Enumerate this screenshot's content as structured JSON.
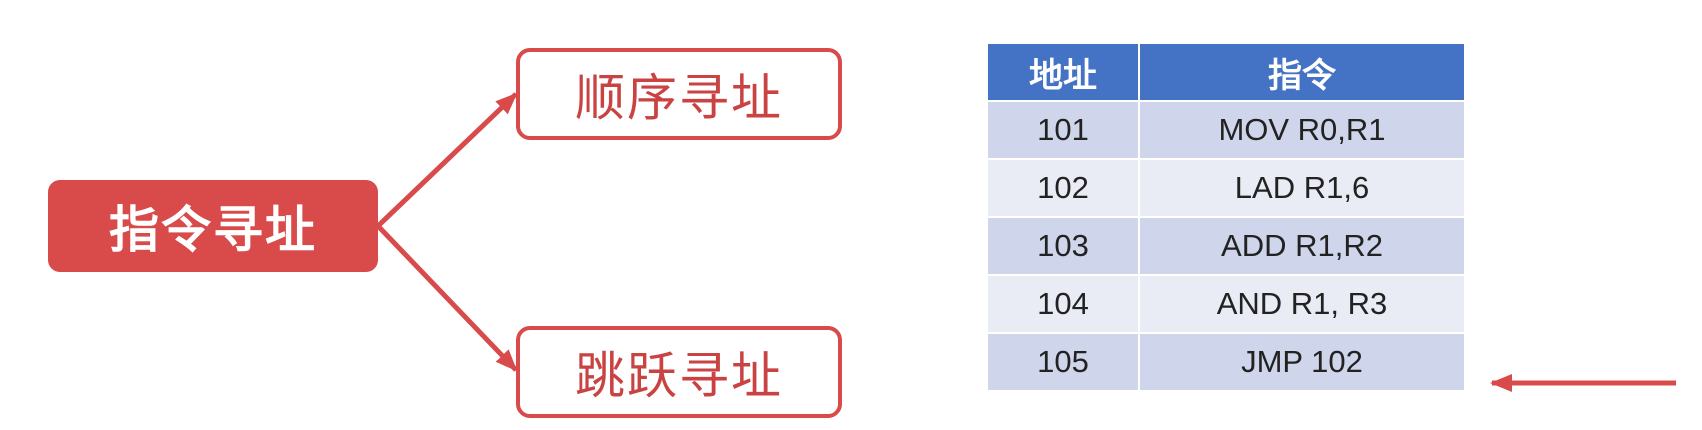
{
  "diagram": {
    "root": {
      "label": "指令寻址"
    },
    "children": [
      {
        "label": "顺序寻址"
      },
      {
        "label": "跳跃寻址"
      }
    ],
    "colors": {
      "accent": "#d94a4a",
      "table_header": "#4472c4",
      "row_dark": "#cfd5ea",
      "row_light": "#e9ebf5"
    }
  },
  "table": {
    "headers": [
      "地址",
      "指令"
    ],
    "rows": [
      {
        "address": "101",
        "instruction": "MOV R0,R1"
      },
      {
        "address": "102",
        "instruction": "LAD R1,6"
      },
      {
        "address": "103",
        "instruction": "ADD R1,R2"
      },
      {
        "address": "104",
        "instruction": "AND R1, R3"
      },
      {
        "address": "105",
        "instruction": "JMP 102"
      }
    ],
    "pointer": {
      "row_index": 4
    }
  }
}
